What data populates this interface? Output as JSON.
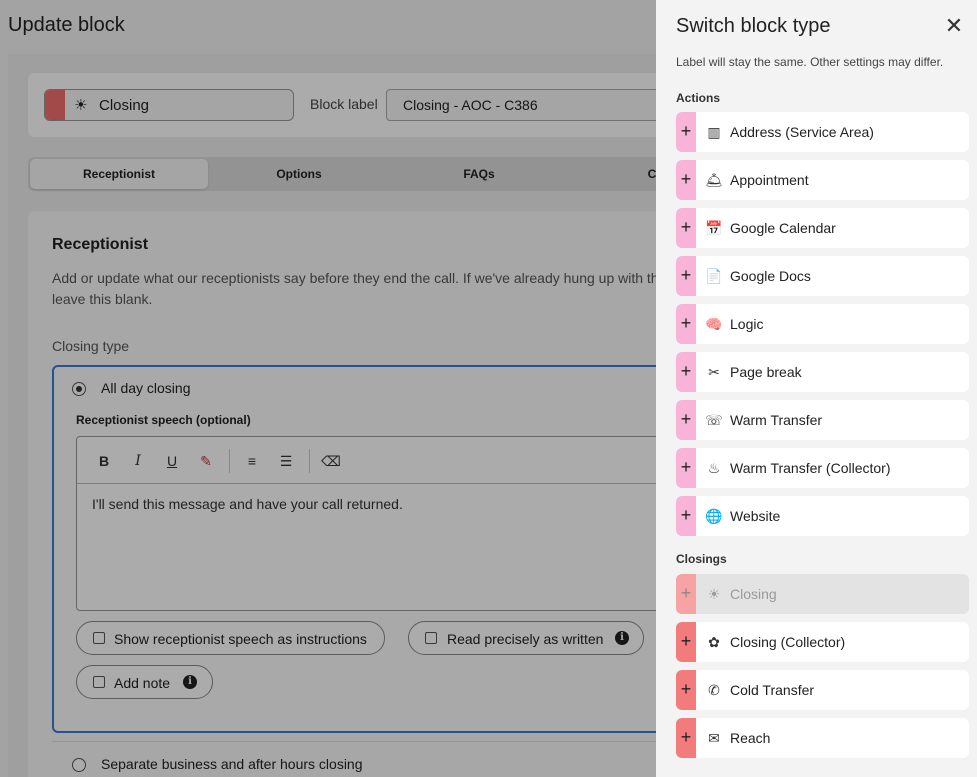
{
  "page": {
    "title": "Update block",
    "block_type": {
      "name": "Closing",
      "icon": "sunset-icon",
      "color": "#f26d6d"
    },
    "block_label": {
      "label": "Block label",
      "value": "Closing - AOC - C386"
    },
    "tabs": [
      {
        "label": "Receptionist",
        "active": true
      },
      {
        "label": "Options",
        "active": false
      },
      {
        "label": "FAQs",
        "active": false
      },
      {
        "label": "Coll",
        "active": false
      }
    ],
    "section": {
      "title": "Receptionist",
      "description": "Add or update what our receptionists say before they end the call. If we've already hung up with th leave this blank.",
      "closing_type_label": "Closing type",
      "options": [
        {
          "label": "All day closing",
          "selected": true
        },
        {
          "label": "Separate business and after hours closing",
          "selected": false
        }
      ],
      "speech_label": "Receptionist speech (optional)",
      "speech_text": "I'll send this message and have your call returned.",
      "toolbar": [
        {
          "name": "bold-button",
          "glyph": "B"
        },
        {
          "name": "italic-button",
          "glyph": "I"
        },
        {
          "name": "underline-button",
          "glyph": "U"
        },
        {
          "name": "highlight-button",
          "glyph": "✎"
        },
        {
          "name": "ordered-list-button",
          "glyph": "≡"
        },
        {
          "name": "bullet-list-button",
          "glyph": "☰"
        },
        {
          "name": "clear-format-button",
          "glyph": "⌫"
        }
      ],
      "checkboxes": {
        "show_instructions": "Show receptionist speech as instructions",
        "read_precisely": "Read precisely as written",
        "add_note": "Add note"
      },
      "info_glyph": "i"
    }
  },
  "drawer": {
    "title": "Switch block type",
    "subtitle": "Label will stay the same. Other settings may differ.",
    "close_glyph": "✕",
    "add_glyph": "+",
    "action_color": "#f7b4d6",
    "closing_color": "#f27c7c",
    "groups": {
      "actions": {
        "title": "Actions",
        "items": [
          {
            "label": "Address (Service Area)",
            "icon": "address-columns-icon",
            "glyph": "▥"
          },
          {
            "label": "Appointment",
            "icon": "service-bell-icon",
            "glyph": "🛎"
          },
          {
            "label": "Google Calendar",
            "icon": "calendar-icon",
            "glyph": "📅"
          },
          {
            "label": "Google Docs",
            "icon": "document-icon",
            "glyph": "📄"
          },
          {
            "label": "Logic",
            "icon": "logic-head-icon",
            "glyph": "🧠"
          },
          {
            "label": "Page break",
            "icon": "page-break-icon",
            "glyph": "✂"
          },
          {
            "label": "Warm Transfer",
            "icon": "warm-transfer-icon",
            "glyph": "☏"
          },
          {
            "label": "Warm Transfer (Collector)",
            "icon": "warm-transfer-collector-icon",
            "glyph": "♨"
          },
          {
            "label": "Website",
            "icon": "globe-icon",
            "glyph": "🌐"
          }
        ]
      },
      "closings": {
        "title": "Closings",
        "items": [
          {
            "label": "Closing",
            "icon": "sunset-icon",
            "glyph": "☀",
            "disabled": true
          },
          {
            "label": "Closing (Collector)",
            "icon": "closing-collector-icon",
            "glyph": "✿"
          },
          {
            "label": "Cold Transfer",
            "icon": "cold-transfer-icon",
            "glyph": "✆"
          },
          {
            "label": "Reach",
            "icon": "reach-icon",
            "glyph": "✉"
          }
        ]
      }
    }
  }
}
